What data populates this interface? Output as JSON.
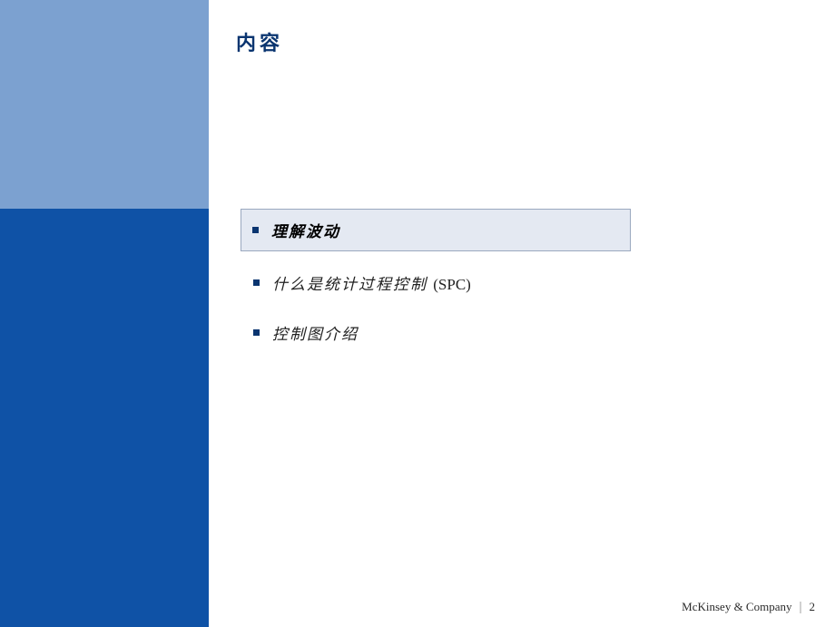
{
  "colors": {
    "sidebar_top": "#7ca1d0",
    "sidebar_bottom": "#0f52a6",
    "title": "#0a3570",
    "bullet": "#0a3570",
    "highlight_bg": "#e4e9f2",
    "highlight_border": "#9aa8bf"
  },
  "title": "内容",
  "items": [
    {
      "label": "理解波动",
      "highlighted": true
    },
    {
      "label": "什么是统计过程控制 ",
      "suffix": "(SPC)",
      "highlighted": false
    },
    {
      "label": "控制图介绍",
      "highlighted": false
    }
  ],
  "footer": {
    "company": "McKinsey & Company",
    "page": "2"
  }
}
